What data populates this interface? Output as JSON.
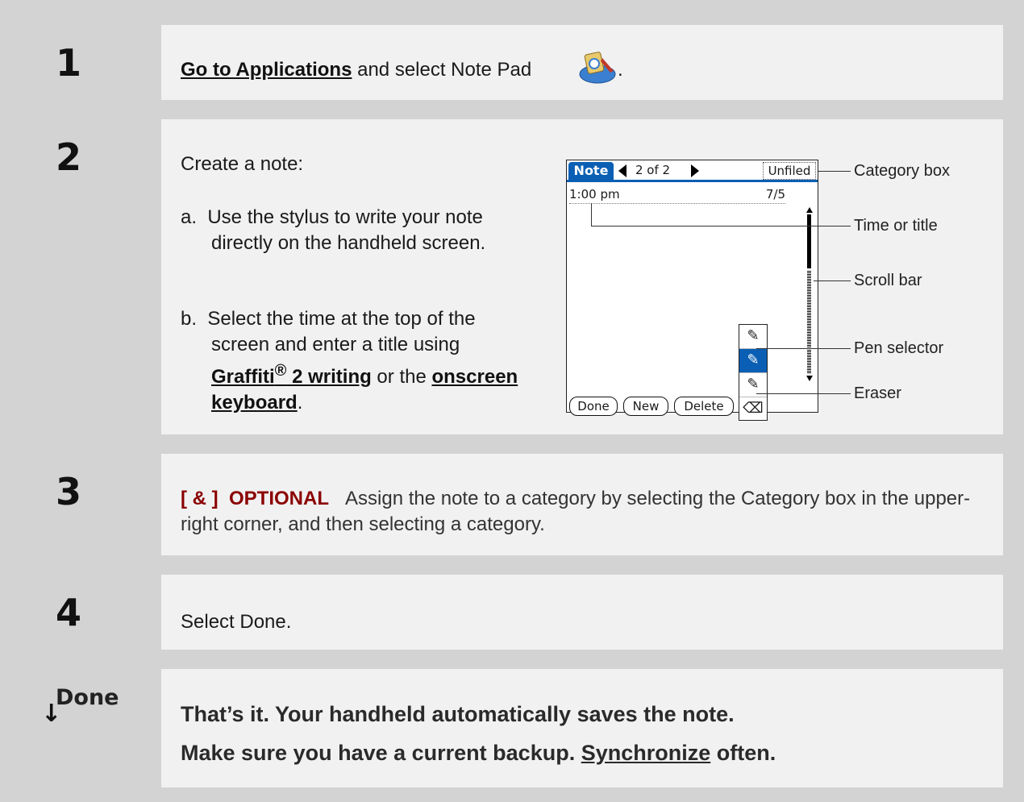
{
  "steps": [
    {
      "number": "1",
      "link": "Go to Applications",
      "text": " and select Note Pad ",
      "tail": "."
    },
    {
      "number": "2",
      "intro": "Create a note:",
      "item_a": "a.  Use the stylus to write your note directly on the handheld screen.",
      "item_b_prefix": "b.  Select the time at the top of the screen and enter a title using ",
      "item_b_link1": "Graffiti",
      "item_b_reg": "®",
      "item_b_link1b": " 2 writing",
      "item_b_mid": " or the ",
      "item_b_link2": "onscreen keyboard",
      "item_b_end": "."
    },
    {
      "number": "3",
      "tag": "[ & ]  OPTIONAL",
      "text": "Assign the note to a category by selecting the Category box in the upper-right corner, and then selecting a category."
    },
    {
      "number": "4",
      "text": "Select Done."
    }
  ],
  "handheld": {
    "tab": "Note",
    "page_indicator": "2 of 2",
    "category": "Unfiled",
    "time": "1:00 pm",
    "date": "7/5",
    "buttons": [
      "Done",
      "New",
      "Delete"
    ]
  },
  "callouts": {
    "category": "Category box",
    "time": "Time or title",
    "scroll": "Scroll bar",
    "pen": "Pen selector",
    "eraser": "Eraser"
  },
  "done": {
    "icon": "↓",
    "label": "Done",
    "line1": "That’s it. Your handheld automatically saves the note.",
    "line2_prefix": "Make sure you have a current backup. ",
    "line2_link": "Synchronize",
    "line2_suffix": " often."
  }
}
